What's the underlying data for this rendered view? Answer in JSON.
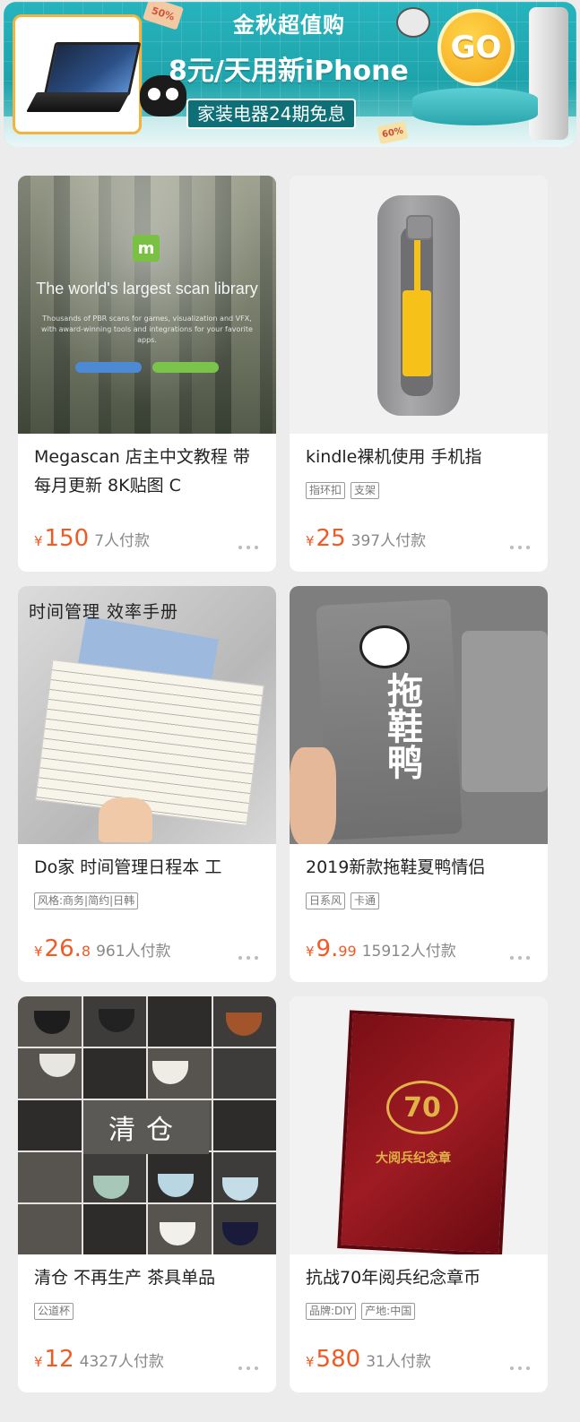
{
  "banner": {
    "title": "金秋超值购",
    "headline": "8元/天用新iPhone",
    "subtitle": "家装电器24期免息",
    "go_label": "GO",
    "tag_left": "50%",
    "tag_right": "60%",
    "forest_logo": "m",
    "forest_headline": "The world's largest scan library",
    "forest_sub": "Thousands of PBR scans for games, visualization and VFX, with award-winning tools and integrations for your favorite apps.",
    "notebook_cover": "时间管理 效率手册",
    "slipper_print": "拖鞋鸭",
    "tea_print": "清仓",
    "medal_emblem": "70",
    "medal_text": "大阅兵纪念章"
  },
  "products": [
    {
      "title": "Megascan 店主中文教程 带每月更新 8K贴图 C",
      "tags": [],
      "currency": "¥",
      "price": "150",
      "price_decimal": "",
      "sales": "7人付款"
    },
    {
      "title": "kindle裸机使用 手机指",
      "tags": [
        "指环扣",
        "支架"
      ],
      "currency": "¥",
      "price": "25",
      "price_decimal": "",
      "sales": "397人付款"
    },
    {
      "title": "Do家 时间管理日程本 工",
      "tags": [
        "风格:商务|简约|日韩"
      ],
      "currency": "¥",
      "price": "26.",
      "price_decimal": "8",
      "sales": "961人付款"
    },
    {
      "title": "2019新款拖鞋夏鸭情侣",
      "tags": [
        "日系风",
        "卡通"
      ],
      "currency": "¥",
      "price": "9.",
      "price_decimal": "99",
      "sales": "15912人付款"
    },
    {
      "title": "清仓 不再生产 茶具单品",
      "tags": [
        "公道杯"
      ],
      "currency": "¥",
      "price": "12",
      "price_decimal": "",
      "sales": "4327人付款"
    },
    {
      "title": "抗战70年阅兵纪念章币",
      "tags": [
        "品牌:DIY",
        "产地:中国"
      ],
      "currency": "¥",
      "price": "580",
      "price_decimal": "",
      "sales": "31人付款"
    }
  ],
  "colors": {
    "price": "#f15a24",
    "banner_bg": "#1ea3ab",
    "go_button": "#f3a51a"
  },
  "icons": {
    "more": "more-dots-icon"
  }
}
